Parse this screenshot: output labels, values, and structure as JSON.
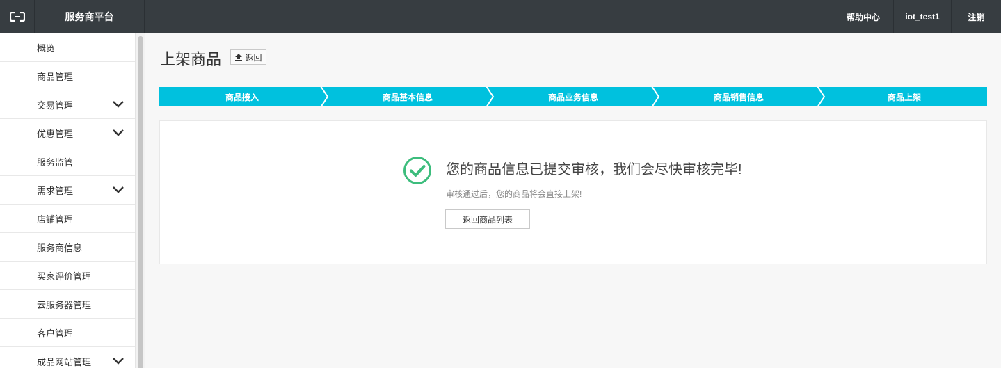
{
  "header": {
    "logo_icon": "aliyun-logo-icon",
    "brand": "服务商平台",
    "nav": {
      "help": "帮助中心",
      "user": "iot_test1",
      "logout": "注销"
    }
  },
  "sidebar": {
    "items": [
      {
        "label": "概览",
        "expandable": false
      },
      {
        "label": "商品管理",
        "expandable": false
      },
      {
        "label": "交易管理",
        "expandable": true
      },
      {
        "label": "优惠管理",
        "expandable": true
      },
      {
        "label": "服务监管",
        "expandable": false
      },
      {
        "label": "需求管理",
        "expandable": true
      },
      {
        "label": "店铺管理",
        "expandable": false
      },
      {
        "label": "服务商信息",
        "expandable": false
      },
      {
        "label": "买家评价管理",
        "expandable": false
      },
      {
        "label": "云服务器管理",
        "expandable": false
      },
      {
        "label": "客户管理",
        "expandable": false
      },
      {
        "label": "成品网站管理",
        "expandable": true
      }
    ]
  },
  "page": {
    "title": "上架商品",
    "back_label": "返回"
  },
  "steps": [
    "商品接入",
    "商品基本信息",
    "商品业务信息",
    "商品销售信息",
    "商品上架"
  ],
  "colors": {
    "topbar": "#373d41",
    "step": "#00c1de",
    "success": "#3dbd7d"
  },
  "result": {
    "icon": "check-circle-icon",
    "title": "您的商品信息已提交审核，我们会尽快审核完毕!",
    "subtitle": "审核通过后，您的商品将会直接上架!",
    "button": "返回商品列表"
  }
}
